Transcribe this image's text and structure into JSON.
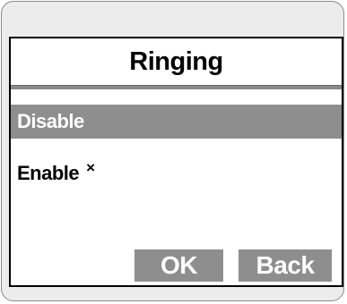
{
  "screen": {
    "title": "Ringing"
  },
  "menu": {
    "items": [
      {
        "label": "Disable",
        "selected": true,
        "checked": false
      },
      {
        "label": "Enable",
        "selected": false,
        "checked": true
      }
    ],
    "check_symbol": "×"
  },
  "softkeys": {
    "ok_label": "OK",
    "back_label": "Back"
  },
  "colors": {
    "selection": "#8e8e8e",
    "frame": "#ececec",
    "text": "#000000"
  }
}
